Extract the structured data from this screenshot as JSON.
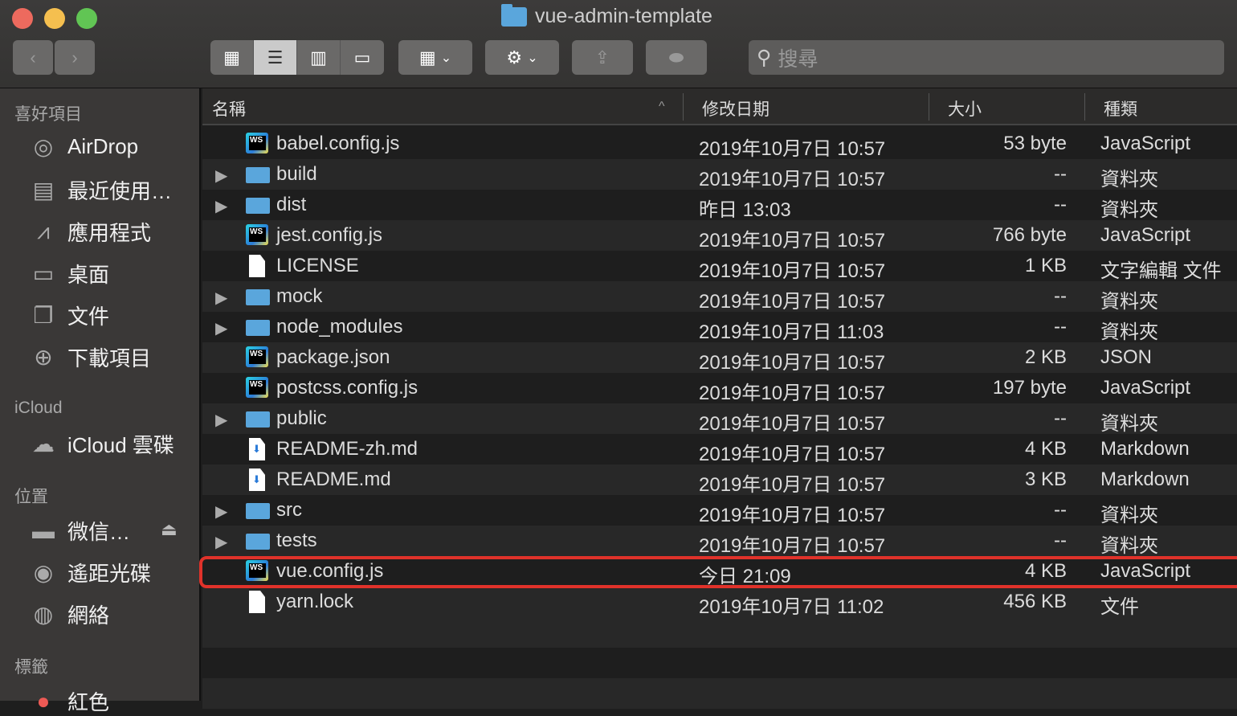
{
  "window": {
    "title": "vue-admin-template",
    "lights": [
      "#ed6a5e",
      "#f5bf4f",
      "#61c554"
    ]
  },
  "toolbar": {
    "back": "‹",
    "forward": "›",
    "views": [
      "icon-view",
      "list-view",
      "column-view",
      "gallery-view"
    ],
    "search_placeholder": "搜尋"
  },
  "sidebar": {
    "favorites_label": "喜好項目",
    "favorites": [
      {
        "label": "AirDrop",
        "icon": "airdrop-icon"
      },
      {
        "label": "最近使用…",
        "icon": "recents-icon"
      },
      {
        "label": "應用程式",
        "icon": "applications-icon"
      },
      {
        "label": "桌面",
        "icon": "desktop-icon"
      },
      {
        "label": "文件",
        "icon": "documents-icon"
      },
      {
        "label": "下載項目",
        "icon": "downloads-icon"
      }
    ],
    "icloud_label": "iCloud",
    "icloud": [
      {
        "label": "iCloud 雲碟",
        "icon": "cloud-icon"
      }
    ],
    "locations_label": "位置",
    "locations": [
      {
        "label": "微信…",
        "icon": "disk-icon"
      },
      {
        "label": "遙距光碟",
        "icon": "optical-disc-icon"
      },
      {
        "label": "網絡",
        "icon": "network-icon"
      }
    ],
    "tags_label": "標籤",
    "tags": [
      {
        "label": "紅色",
        "color": "#ee5a55"
      }
    ]
  },
  "columns": {
    "name": "名稱",
    "date": "修改日期",
    "size": "大小",
    "kind": "種類"
  },
  "files": [
    {
      "name": "babel.config.js",
      "date": "2019年10月7日 10:57",
      "size": "53 byte",
      "kind": "JavaScript",
      "type": "ws"
    },
    {
      "name": "build",
      "date": "2019年10月7日 10:57",
      "size": "--",
      "kind": "資料夾",
      "type": "folder"
    },
    {
      "name": "dist",
      "date": "昨日 13:03",
      "size": "--",
      "kind": "資料夾",
      "type": "folder"
    },
    {
      "name": "jest.config.js",
      "date": "2019年10月7日 10:57",
      "size": "766 byte",
      "kind": "JavaScript",
      "type": "ws"
    },
    {
      "name": "LICENSE",
      "date": "2019年10月7日 10:57",
      "size": "1 KB",
      "kind": "文字編輯 文件",
      "type": "doc"
    },
    {
      "name": "mock",
      "date": "2019年10月7日 10:57",
      "size": "--",
      "kind": "資料夾",
      "type": "folder"
    },
    {
      "name": "node_modules",
      "date": "2019年10月7日 11:03",
      "size": "--",
      "kind": "資料夾",
      "type": "folder"
    },
    {
      "name": "package.json",
      "date": "2019年10月7日 10:57",
      "size": "2 KB",
      "kind": "JSON",
      "type": "ws"
    },
    {
      "name": "postcss.config.js",
      "date": "2019年10月7日 10:57",
      "size": "197 byte",
      "kind": "JavaScript",
      "type": "ws"
    },
    {
      "name": "public",
      "date": "2019年10月7日 10:57",
      "size": "--",
      "kind": "資料夾",
      "type": "folder"
    },
    {
      "name": "README-zh.md",
      "date": "2019年10月7日 10:57",
      "size": "4 KB",
      "kind": "Markdown",
      "type": "md"
    },
    {
      "name": "README.md",
      "date": "2019年10月7日 10:57",
      "size": "3 KB",
      "kind": "Markdown",
      "type": "md"
    },
    {
      "name": "src",
      "date": "2019年10月7日 10:57",
      "size": "--",
      "kind": "資料夾",
      "type": "folder"
    },
    {
      "name": "tests",
      "date": "2019年10月7日 10:57",
      "size": "--",
      "kind": "資料夾",
      "type": "folder"
    },
    {
      "name": "vue.config.js",
      "date": "今日 21:09",
      "size": "4 KB",
      "kind": "JavaScript",
      "type": "ws",
      "highlighted": true
    },
    {
      "name": "yarn.lock",
      "date": "2019年10月7日 11:02",
      "size": "456 KB",
      "kind": "文件",
      "type": "doc"
    }
  ]
}
